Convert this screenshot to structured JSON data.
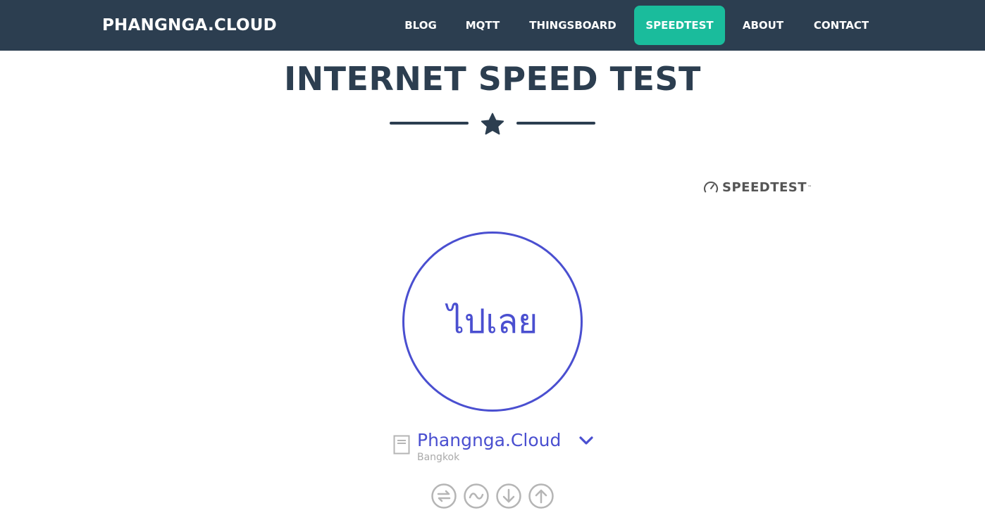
{
  "navbar": {
    "brand": "PHANGNGA.CLOUD",
    "items": [
      {
        "label": "BLOG",
        "active": false
      },
      {
        "label": "MQTT",
        "active": false
      },
      {
        "label": "THINGSBOARD",
        "active": false
      },
      {
        "label": "SPEEDTEST",
        "active": true
      },
      {
        "label": "ABOUT",
        "active": false
      },
      {
        "label": "CONTACT",
        "active": false
      }
    ]
  },
  "header": {
    "title": "INTERNET SPEED TEST",
    "divider_icon": "star-icon"
  },
  "speedtest": {
    "logo_text": "SPEEDTEST",
    "logo_icon": "speedometer-icon",
    "go_label": "ไปเลย",
    "server": {
      "name": "Phangnga.Cloud",
      "location": "Bangkok",
      "icon": "server-icon"
    },
    "metric_icons": [
      "ping-icon",
      "jitter-icon",
      "download-icon",
      "upload-icon"
    ]
  },
  "colors": {
    "navbar_bg": "#2c3e50",
    "active_nav": "#1abc9c",
    "accent": "#4a4fd0",
    "metric_icon": "#b5b5b5"
  }
}
